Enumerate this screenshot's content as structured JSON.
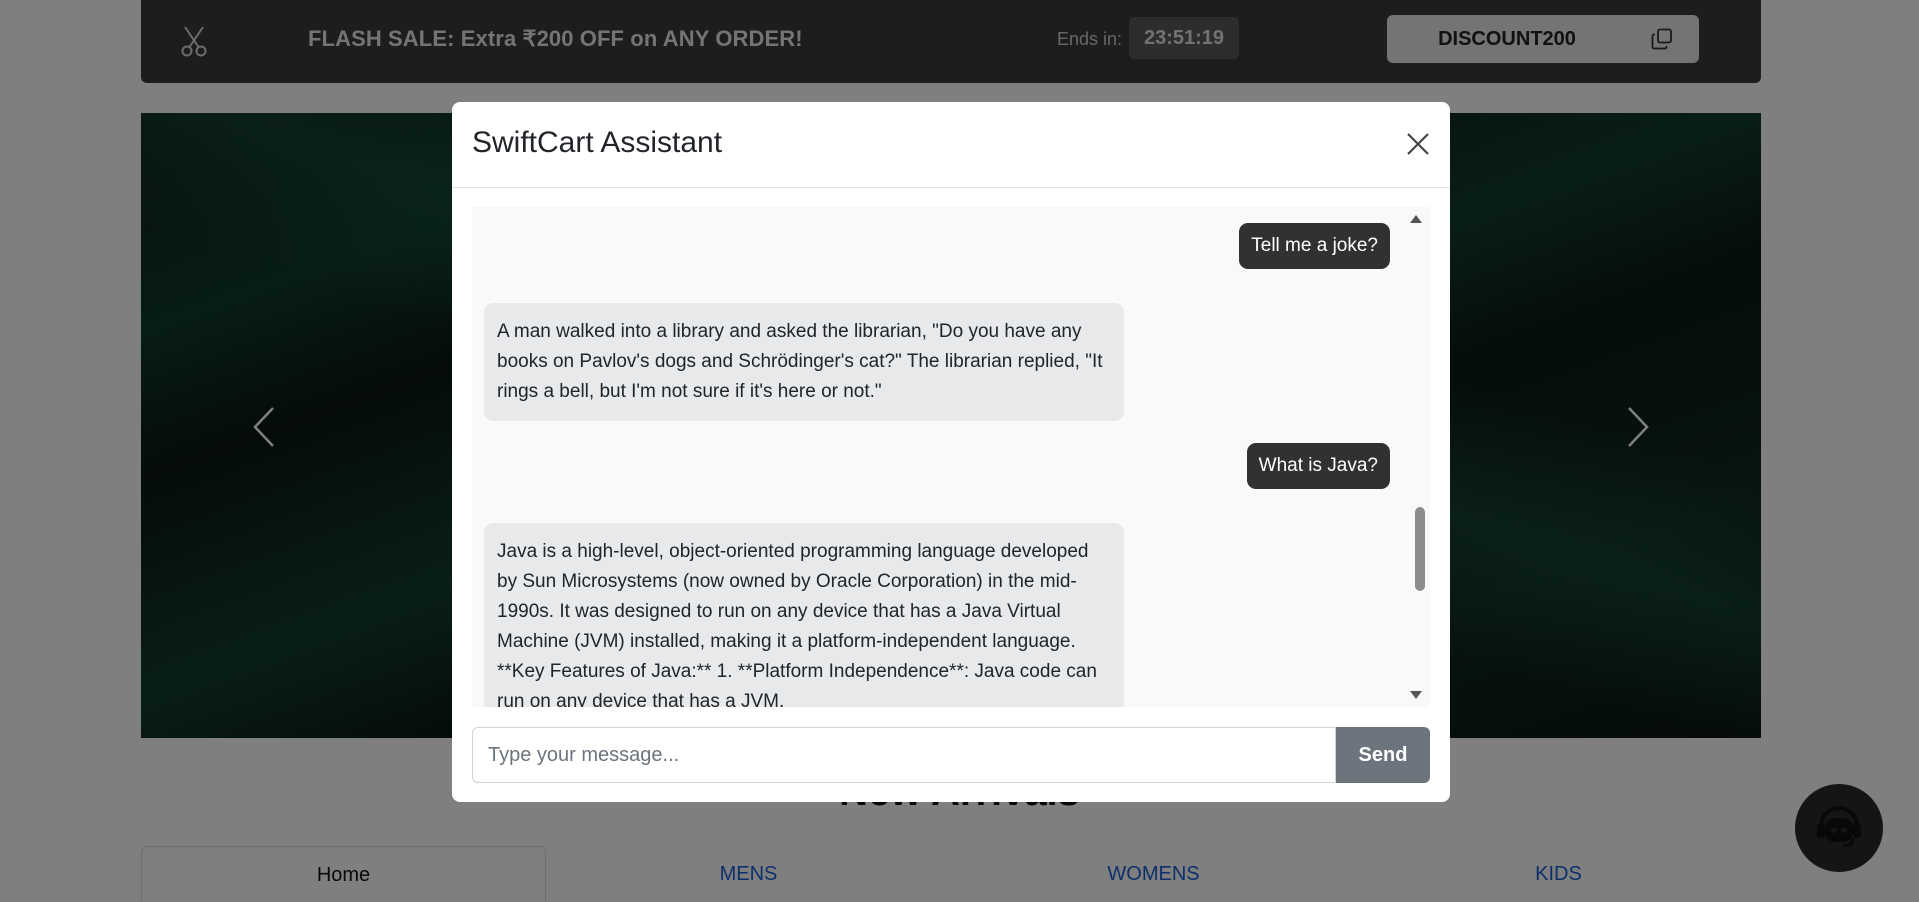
{
  "flash_bar": {
    "message": "FLASH SALE: Extra ₹200 OFF on ANY ORDER!",
    "ends_label": "Ends in:",
    "timer": "23:51:19",
    "coupon_code": "DISCOUNT200"
  },
  "section": {
    "title": "New Arrivals"
  },
  "tabs": [
    {
      "label": "Home"
    },
    {
      "label": "MENS"
    },
    {
      "label": "WOMENS"
    },
    {
      "label": "KIDS"
    }
  ],
  "modal": {
    "title": "SwiftCart Assistant",
    "messages": [
      {
        "role": "user",
        "text": "Tell me a joke?"
      },
      {
        "role": "bot",
        "text": "A man walked into a library and asked the librarian, \"Do you have any books on Pavlov's dogs and Schrödinger's cat?\" The librarian replied, \"It rings a bell, but I'm not sure if it's here or not.\""
      },
      {
        "role": "user",
        "text": "What is Java?"
      },
      {
        "role": "bot",
        "text": "Java is a high-level, object-oriented programming language developed by Sun Microsystems (now owned by Oracle Corporation) in the mid-1990s. It was designed to run on any device that has a Java Virtual Machine (JVM) installed, making it a platform-independent language. **Key Features of Java:** 1. **Platform Independence**: Java code can run on any device that has a JVM."
      }
    ],
    "input_placeholder": "Type your message...",
    "input_value": "",
    "send_label": "Send"
  },
  "colors": {
    "flash_bg": "#3a3a3a",
    "user_bubble": "#2f3133",
    "bot_bubble": "#e7e9eb",
    "send_button": "#6c757d",
    "tab_link": "#1a5fd6"
  },
  "icons": [
    "scissors-icon",
    "copy-icon",
    "chevron-left-icon",
    "chevron-right-icon",
    "close-icon",
    "chatbot-icon"
  ]
}
